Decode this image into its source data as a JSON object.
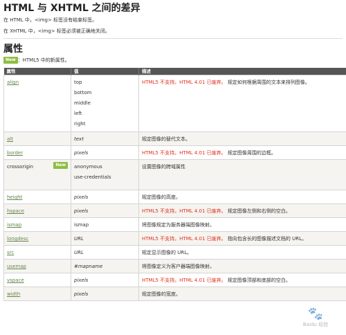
{
  "diff": {
    "title": "HTML 与 XHTML 之间的差异",
    "line1": "在 HTML 中，<img> 标签没有结束标签。",
    "line2": "在 XHTML 中，<img> 标签必须被正确地关闭。"
  },
  "attrs": {
    "title": "属性",
    "badge": "New",
    "note": "：HTML5 中的新属性。"
  },
  "table": {
    "headers": [
      "属性",
      "值",
      "描述"
    ],
    "rows": [
      {
        "attr": "align",
        "values": [
          "top",
          "bottom",
          "middle",
          "left",
          "right"
        ],
        "italic": false,
        "desc_red": "HTML5 不支持。HTML 4.01 已废弃。",
        "desc": "规定如何根据周围的文本来排列图像。"
      },
      {
        "attr": "alt",
        "values": [
          "text"
        ],
        "italic": true,
        "desc_red": "",
        "desc": "规定图像的替代文本。"
      },
      {
        "attr": "border",
        "values": [
          "pixels"
        ],
        "italic": true,
        "desc_red": "HTML5 不支持。HTML 4.01 已废弃。",
        "desc": "规定图像周围的边框。"
      },
      {
        "attr": "crossorigin",
        "badge": "New",
        "values": [
          "anonymous",
          "use-credentials"
        ],
        "italic": false,
        "desc_red": "",
        "desc": "设置图像的跨域属性"
      },
      {
        "attr": "height",
        "values": [
          "pixels"
        ],
        "italic": true,
        "desc_red": "",
        "desc": "规定图像的高度。"
      },
      {
        "attr": "hspace",
        "values": [
          "pixels"
        ],
        "italic": true,
        "desc_red": "HTML5 不支持。HTML 4.01 已废弃。",
        "desc": "规定图像左侧和右侧的空白。"
      },
      {
        "attr": "ismap",
        "values": [
          "ismap"
        ],
        "italic": false,
        "desc_red": "",
        "desc": "将图像规定为服务器端图像映射。"
      },
      {
        "attr": "longdesc",
        "values": [
          "URL"
        ],
        "italic": true,
        "desc_red": "HTML5 不支持。HTML 4.01 已废弃。",
        "desc": "指向包含长的图像描述文档的 URL。"
      },
      {
        "attr": "src",
        "values": [
          "URL"
        ],
        "italic": true,
        "desc_red": "",
        "desc": "规定显示图像的 URL。"
      },
      {
        "attr": "usemap",
        "values": [
          "#mapname"
        ],
        "italic": true,
        "desc_red": "",
        "desc": "将图像定义为客户器端图像映射。"
      },
      {
        "attr": "vspace",
        "values": [
          "pixels"
        ],
        "italic": true,
        "desc_red": "HTML5 不支持。HTML 4.01 已废弃。",
        "desc": "规定图像顶部和底部的空白。"
      },
      {
        "attr": "width",
        "values": [
          "pixels"
        ],
        "italic": true,
        "desc_red": "",
        "desc": "规定图像的宽度。"
      }
    ]
  },
  "watermark": {
    "text": "Baidu 经验",
    "icon": "paw-icon"
  }
}
